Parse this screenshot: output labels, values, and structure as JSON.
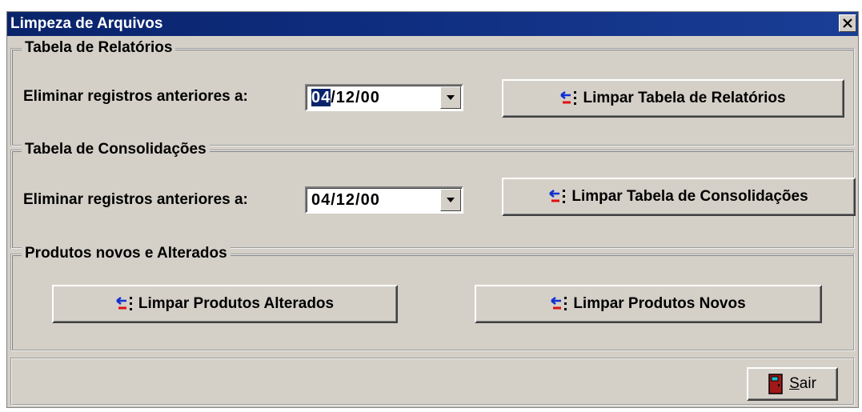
{
  "window": {
    "title": "Limpeza de Arquivos",
    "close_glyph": "✕"
  },
  "group_relatorios": {
    "legend": "Tabela de Relatórios",
    "label": "Eliminar registros anteriores a:",
    "date_selected_part": "04",
    "date_rest": "/12/00",
    "button_label": "Limpar Tabela de Relatórios"
  },
  "group_consolidacoes": {
    "legend": "Tabela de Consolidações",
    "label": "Eliminar registros anteriores a:",
    "date_value": "04/12/00",
    "button_label": "Limpar Tabela de Consolidações"
  },
  "group_produtos": {
    "legend": "Produtos novos e Alterados",
    "button_alterados_label": "Limpar Produtos Alterados",
    "button_novos_label": "Limpar Produtos Novos"
  },
  "footer": {
    "exit_underlined": "S",
    "exit_rest": "air"
  },
  "icons": {
    "clear_icon": "clear-table-icon",
    "exit_icon": "door-exit-icon",
    "dropdown_icon": "chevron-down-icon"
  },
  "colors": {
    "titlebar": "#0a246a",
    "face": "#d4d0c8",
    "selection": "#0a246a"
  }
}
